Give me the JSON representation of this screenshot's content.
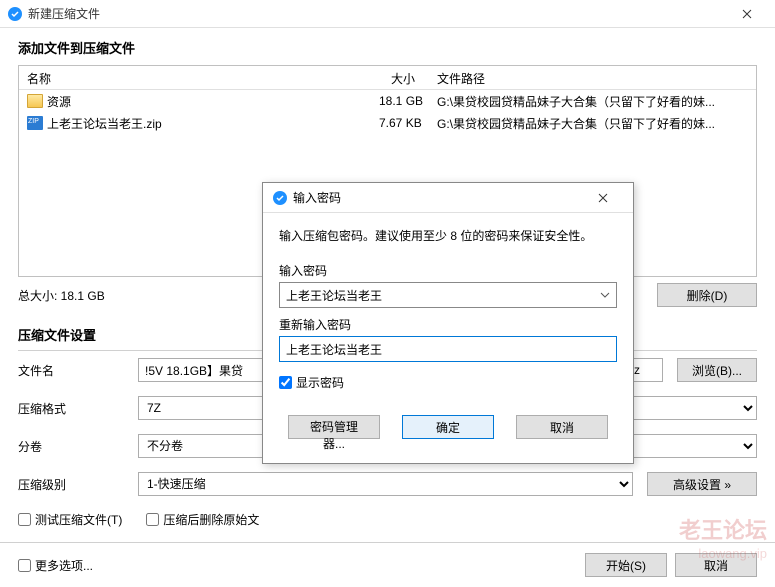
{
  "window": {
    "title": "新建压缩文件",
    "close_icon": "close-icon"
  },
  "add_section_title": "添加文件到压缩文件",
  "table": {
    "headers": {
      "name": "名称",
      "size": "大小",
      "path": "文件路径"
    },
    "rows": [
      {
        "icon": "folder",
        "name": "资源",
        "size": "18.1 GB",
        "path": "G:\\果贷校园贷精品妹子大合集（只留下了好看的妹..."
      },
      {
        "icon": "zip",
        "name": "上老王论坛当老王.zip",
        "size": "7.67 KB",
        "path": "G:\\果贷校园贷精品妹子大合集（只留下了好看的妹..."
      }
    ]
  },
  "total_label": "总大小: 18.1 GB",
  "delete_btn": "删除(D)",
  "settings_title": "压缩文件设置",
  "form": {
    "filename_label": "文件名",
    "filename_value": "!5V 18.1GB】果贷",
    "ext": ".7z",
    "browse": "浏览(B)...",
    "format_label": "压缩格式",
    "format_value": "7Z",
    "volume_label": "分卷",
    "volume_value": "不分卷",
    "level_label": "压缩级别",
    "level_value": "1-快速压缩",
    "advanced": "高级设置 »"
  },
  "checkboxes": {
    "test": "测试压缩文件(T)",
    "delete_src": "压缩后删除原始文",
    "more": "更多选项..."
  },
  "bottom": {
    "start": "开始(S)",
    "cancel": "取消"
  },
  "password_dialog": {
    "title": "输入密码",
    "hint": "输入压缩包密码。建议使用至少 8 位的密码来保证安全性。",
    "enter_label": "输入密码",
    "password_value": "上老王论坛当老王",
    "reenter_label": "重新输入密码",
    "reenter_value": "上老王论坛当老王",
    "show_password": "显示密码",
    "manager": "密码管理器...",
    "ok": "确定",
    "cancel": "取消"
  },
  "watermark": {
    "line1": "老王论坛",
    "line2": "laowang.vip"
  }
}
